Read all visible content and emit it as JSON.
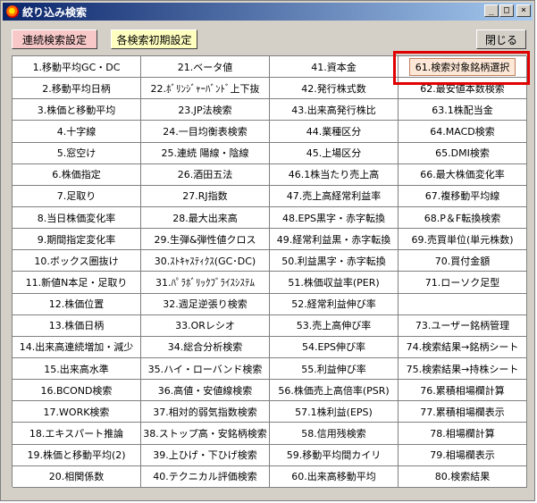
{
  "window": {
    "title": "絞り込み検索"
  },
  "buttons": {
    "continuous": "連続検索設定",
    "initialize": "各検索初期設定",
    "close": "閉じる"
  },
  "columns": [
    [
      "1.移動平均GC・DC",
      "2.移動平均日柄",
      "3.株価と移動平均",
      "4.十字線",
      "5.窓空け",
      "6.株価指定",
      "7.足取り",
      "8.当日株価変化率",
      "9.期間指定変化率",
      "10.ボックス圏抜け",
      "11.新値N本足・足取り",
      "12.株価位置",
      "13.株価日柄",
      "14.出来高連続増加・減少",
      "15.出来高水準",
      "16.BCOND検索",
      "17.WORK検索",
      "18.エキスパート推論",
      "19.株価と移動平均(2)",
      "20.相関係数"
    ],
    [
      "21.ベータ値",
      "22.ﾎﾞﾘﾝｼﾞｬｰﾊﾞﾝﾄﾞ上下抜",
      "23.JP法検索",
      "24.一目均衡表検索",
      "25.連続 陽線・陰線",
      "26.酒田五法",
      "27.RJ指数",
      "28.最大出来高",
      "29.生弾&弾性値クロス",
      "30.ｽﾄｷｬｽﾃｨｸｽ(GC･DC)",
      "31.ﾊﾟﾗﾎﾞﾘｯｸﾌﾞﾗｲｽｼｽﾃﾑ",
      "32.週足逆張り検索",
      "33.ORレシオ",
      "34.総合分析検索",
      "35.ハイ・ローバンド検索",
      "36.高値・安値線検索",
      "37.相対的弱気指数検索",
      "38.ストップ高・安銘柄検索",
      "39.上ひげ・下ひげ検索",
      "40.テクニカル評価検索"
    ],
    [
      "41.資本金",
      "42.発行株式数",
      "43.出来高発行株比",
      "44.業種区分",
      "45.上場区分",
      "46.1株当たり売上高",
      "47.売上高経常利益率",
      "48.EPS黒字・赤字転換",
      "49.経常利益黒・赤字転換",
      "50.利益黒字・赤字転換",
      "51.株価収益率(PER)",
      "52.経常利益伸び率",
      "53.売上高伸び率",
      "54.EPS伸び率",
      "55.利益伸び率",
      "56.株価売上高倍率(PSR)",
      "57.1株利益(EPS)",
      "58.信用残検索",
      "59.移動平均間カイリ",
      "60.出来高移動平均"
    ],
    [
      "61.検索対象銘柄選択",
      "62.最安値本数検索",
      "63.1株配当金",
      "64.MACD検索",
      "65.DMI検索",
      "66.最大株価変化率",
      "67.複移動平均線",
      "68.P＆F転換検索",
      "69.売買単位(単元株数)",
      "70.買付金額",
      "71.ローソク足型",
      "",
      "73.ユーザー銘柄管理",
      "74.検索結果→銘柄シート",
      "75.検索結果→持株シート",
      "76.累積相場欄計算",
      "77.累積相場欄表示",
      "78.相場欄計算",
      "79.相場欄表示",
      "80.検索結果"
    ]
  ],
  "selected": "61.検索対象銘柄選択"
}
